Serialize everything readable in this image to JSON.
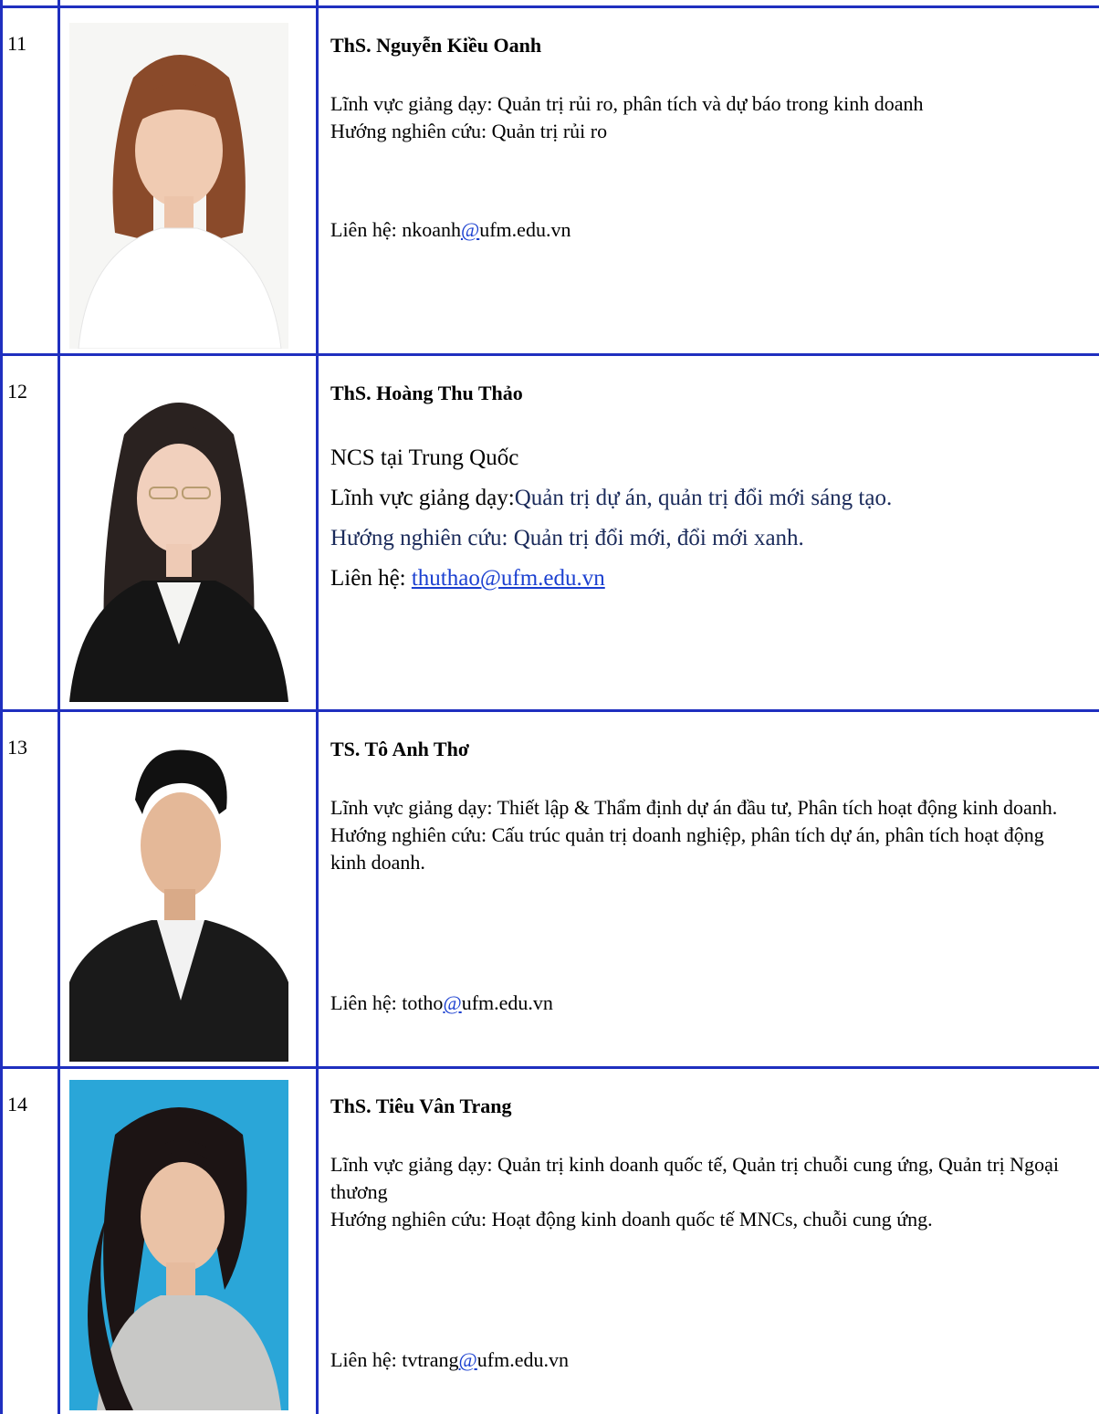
{
  "rows": [
    {
      "no": "11",
      "name": "ThS. Nguyễn Kiều Oanh",
      "teaching": "Lĩnh vực giảng dạy: Quản trị rủi ro, phân tích và dự báo trong kinh doanh",
      "research": "Hướng nghiên cứu: Quản trị rủi ro",
      "contact_label": "Liên hệ: ",
      "contact_user": "nkoanh",
      "contact_at": "@",
      "contact_domain": "ufm.edu.vn"
    },
    {
      "no": "12",
      "name": "ThS. Hoàng Thu Thảo",
      "note": "NCS tại Trung Quốc",
      "teaching_label": "Lĩnh vực giảng dạy:",
      "teaching_value": "Quản trị dự án, quản trị đổi mới sáng tạo.",
      "research": "Hướng nghiên cứu: Quản trị đổi mới, đổi mới xanh.",
      "contact_label": "Liên hệ: ",
      "contact_email": "thuthao@ufm.edu.vn"
    },
    {
      "no": "13",
      "name": "TS. Tô Anh Thơ",
      "teaching": "Lĩnh vực giảng dạy: Thiết lập & Thẩm định dự án đầu tư, Phân tích hoạt động kinh doanh.",
      "research": "Hướng nghiên cứu: Cấu trúc quản trị doanh nghiệp, phân tích dự án, phân tích hoạt động kinh doanh.",
      "contact_label": "Liên hệ: ",
      "contact_user": "totho",
      "contact_at": "@",
      "contact_domain": "ufm.edu.vn"
    },
    {
      "no": "14",
      "name": "ThS. Tiêu Vân Trang",
      "teaching": "Lĩnh vực giảng dạy: Quản trị kinh doanh quốc tế, Quản trị chuỗi cung ứng, Quản trị Ngoại thương",
      "research": "Hướng nghiên cứu: Hoạt động kinh doanh quốc tế MNCs, chuỗi cung ứng.",
      "contact_label": "Liên hệ: ",
      "contact_user": "tvtrang",
      "contact_at": "@",
      "contact_domain": "ufm.edu.vn"
    }
  ],
  "colors": {
    "border": "#1f2fbf",
    "link": "#1a3fd0",
    "navy_text": "#1a2a5a",
    "photo_bg_blue": "#2aa6d8"
  }
}
